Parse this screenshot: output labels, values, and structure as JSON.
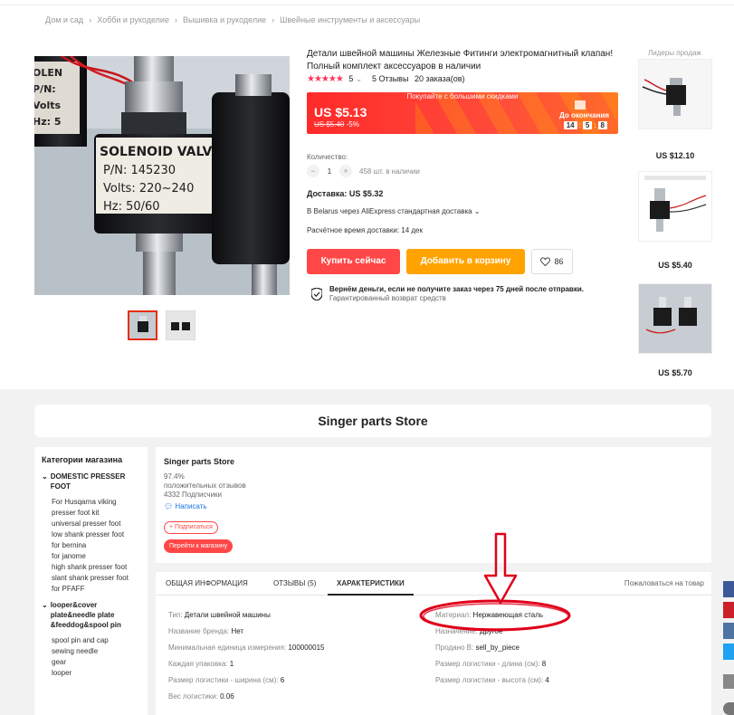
{
  "breadcrumbs": [
    "Дом и сад",
    "Хобби и рукоделие",
    "Вышивка и рукоделие",
    "Швейные инструменты и аксессуары"
  ],
  "product": {
    "title": "Детали швейной машины Железные Фитинги электромагнитный клапан! Полный комплект аксессуаров в наличии",
    "rating": "5",
    "reviews": "5 Отзывы",
    "orders": "20 заказа(ов)",
    "image_text": {
      "line1": "SOLENOID VALVE",
      "line2": "P/N: 145230",
      "line3": "Volts: 220~240",
      "line4": "Hz: 50/60"
    }
  },
  "price": {
    "promo": "Покупайте с большими скидками",
    "current": "US $5.13",
    "old": "US $5.40",
    "discount": "-5%",
    "countdown_label": "До окончания",
    "countdown": [
      "14",
      "5",
      "8"
    ]
  },
  "quantity": {
    "label": "Количество:",
    "minus": "−",
    "value": "1",
    "plus": "+",
    "available": "458 шт. в наличии"
  },
  "shipping": {
    "cost": "Доставка: US $5.32",
    "via": "В Belarus через AliExpress стандартная доставка",
    "eta": "Расчётное время доставки: 14 дек"
  },
  "buttons": {
    "buy": "Купить сейчас",
    "cart": "Добавить в корзину",
    "wishlist_count": "86"
  },
  "guarantee": {
    "line1": "Вернём деньги, если не получите заказ через 75 дней после отправки.",
    "line2": "Гарантированный возврат средств"
  },
  "leaders": {
    "title": "Лидеры продаж",
    "items": [
      {
        "price": "US $12.10"
      },
      {
        "price": "US $5.40"
      },
      {
        "price": "US $5.70"
      }
    ]
  },
  "store": {
    "banner": "Singer parts Store",
    "name": "Singer parts Store",
    "positive_pct": "97.4%",
    "positive_label": "положительных отзывов",
    "subscribers": "4332 Подписчики",
    "write": "Написать",
    "subscribe": "+ Подписаться",
    "go": "Перейти к магазину"
  },
  "categories": {
    "title": "Категории магазина",
    "groups": [
      {
        "name": "DOMESTIC PRESSER FOOT",
        "items": [
          "For Husqarna viking presser foot kit",
          "universal presser foot",
          "low shank presser foot",
          "for bernina",
          "for janome",
          "high shank presser foot",
          "slant shank presser foot",
          "for PFAFF"
        ]
      },
      {
        "name": "looper&cover plate&needle plate &feeddog&spool pin",
        "items": [
          "spool pin and cap",
          "sewing needle",
          "gear",
          "looper"
        ]
      }
    ]
  },
  "details": {
    "tabs": [
      "ОБЩАЯ ИНФОРМАЦИЯ",
      "ОТЗЫВЫ (5)",
      "ХАРАКТЕРИСТИКИ"
    ],
    "active_tab": "ХАРАКТЕРИСТИКИ",
    "complain": "Пожаловаться на товар",
    "left": [
      {
        "k": "Тип:",
        "v": "Детали швейной машины"
      },
      {
        "k": "Название бренда:",
        "v": "Нет"
      },
      {
        "k": "Минимальная единица измерения:",
        "v": "100000015"
      },
      {
        "k": "Каждая упаковка:",
        "v": "1"
      },
      {
        "k": "Размер логистики - ширина (см):",
        "v": "6"
      },
      {
        "k": "Вес логистики:",
        "v": "0.06"
      }
    ],
    "right": [
      {
        "k": "Материал:",
        "v": "Нержавеющая сталь"
      },
      {
        "k": "Назначение:",
        "v": "Другое"
      },
      {
        "k": "Продано В:",
        "v": "sell_by_piece"
      },
      {
        "k": "Размер логистики - длина (см):",
        "v": "8"
      },
      {
        "k": "Размер логистики - высота (см):",
        "v": "4"
      }
    ]
  },
  "colors": {
    "accent": "#ff4747",
    "cart": "#ffa300",
    "annotation": "#e0001a"
  }
}
